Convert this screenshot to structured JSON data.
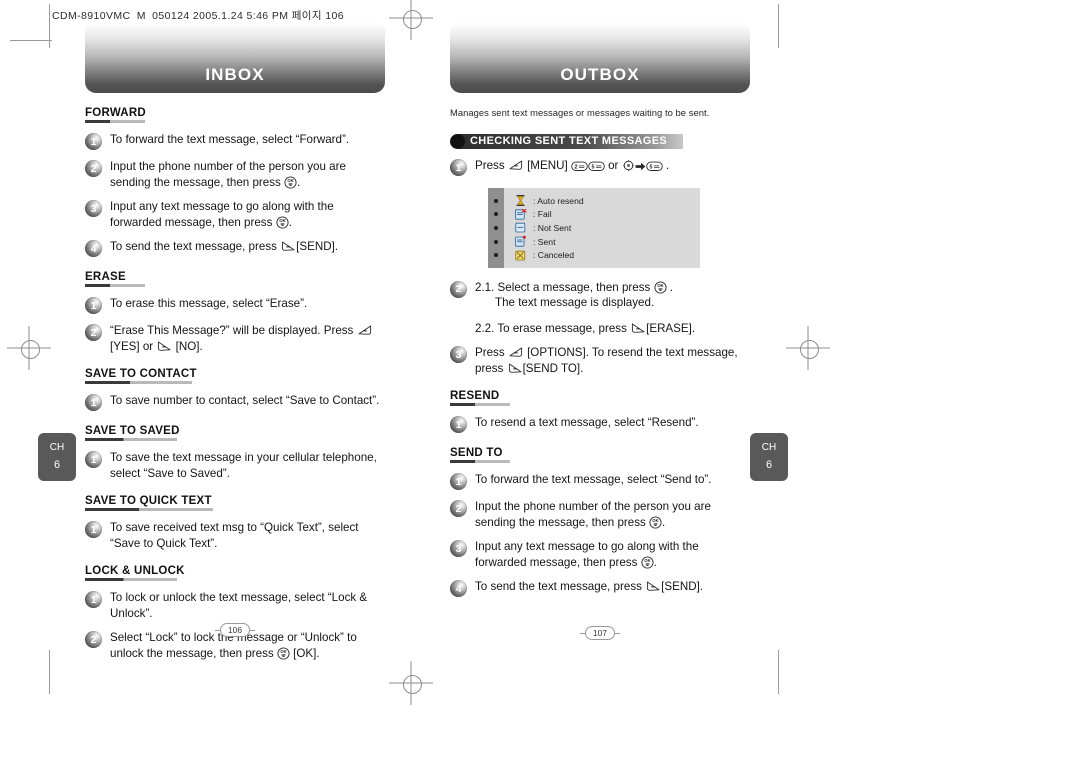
{
  "doc": {
    "header_text": "CDM-8910VMC_M_050124  2005.1.24 5:46 PM 페이지 106"
  },
  "side_tabs": {
    "left": {
      "chapter_label": "CH",
      "chapter_number": "6"
    },
    "right": {
      "chapter_label": "CH",
      "chapter_number": "6"
    }
  },
  "left_page": {
    "banner_title": "INBOX",
    "page_number": "106",
    "sections": [
      {
        "heading": "FORWARD",
        "steps": [
          {
            "num": "1",
            "parts": [
              {
                "t": "text",
                "v": "To forward the text message, select “Forward”."
              }
            ]
          },
          {
            "num": "2",
            "parts": [
              {
                "t": "text",
                "v": "Input the phone number of the person you are sending the message, then press "
              },
              {
                "t": "key",
                "v": "ok-key"
              },
              {
                "t": "text",
                "v": "."
              }
            ]
          },
          {
            "num": "3",
            "parts": [
              {
                "t": "text",
                "v": "Input any text message to go along with the forwarded message, then press "
              },
              {
                "t": "key",
                "v": "ok-key"
              },
              {
                "t": "text",
                "v": "."
              }
            ]
          },
          {
            "num": "4",
            "parts": [
              {
                "t": "text",
                "v": "To send the text message, press "
              },
              {
                "t": "key",
                "v": "right-soft-key"
              },
              {
                "t": "text",
                "v": "[SEND]."
              }
            ]
          }
        ]
      },
      {
        "heading": "ERASE",
        "steps": [
          {
            "num": "1",
            "parts": [
              {
                "t": "text",
                "v": "To erase this message, select “Erase”."
              }
            ]
          },
          {
            "num": "2",
            "parts": [
              {
                "t": "text",
                "v": "“Erase This Message?” will be displayed. Press "
              },
              {
                "t": "key",
                "v": "left-soft-key"
              },
              {
                "t": "text",
                "v": " [YES] or "
              },
              {
                "t": "key",
                "v": "right-soft-key"
              },
              {
                "t": "text",
                "v": " [NO]."
              }
            ]
          }
        ]
      },
      {
        "heading": "SAVE TO CONTACT",
        "steps": [
          {
            "num": "1",
            "parts": [
              {
                "t": "text",
                "v": "To save number to contact, select “Save to Contact”."
              }
            ]
          }
        ]
      },
      {
        "heading": "SAVE TO SAVED",
        "steps": [
          {
            "num": "1",
            "parts": [
              {
                "t": "text",
                "v": "To save the text message in your cellular telephone, select “Save to Saved”."
              }
            ]
          }
        ]
      },
      {
        "heading": "SAVE TO QUICK TEXT",
        "steps": [
          {
            "num": "1",
            "parts": [
              {
                "t": "text",
                "v": "To save received text msg to “Quick Text”, select “Save to Quick Text”."
              }
            ]
          }
        ]
      },
      {
        "heading": "LOCK & UNLOCK",
        "steps": [
          {
            "num": "1",
            "parts": [
              {
                "t": "text",
                "v": "To lock or unlock the text message, select “Lock & Unlock”."
              }
            ]
          },
          {
            "num": "2",
            "parts": [
              {
                "t": "text",
                "v": "Select “Lock” to lock the message or “Unlock” to unlock the message, then press "
              },
              {
                "t": "key",
                "v": "ok-key"
              },
              {
                "t": "text",
                "v": " [OK]."
              }
            ]
          }
        ]
      }
    ]
  },
  "right_page": {
    "banner_title": "OUTBOX",
    "page_number": "107",
    "intro": "Manages sent text messages or messages waiting to be sent.",
    "topic_title": "CHECKING SENT TEXT MESSAGES",
    "topic_steps": [
      {
        "num": "1",
        "parts": [
          {
            "t": "text",
            "v": "Press "
          },
          {
            "t": "key",
            "v": "left-soft-key"
          },
          {
            "t": "text",
            "v": " [MENU] "
          },
          {
            "t": "key",
            "v": "num-2-key"
          },
          {
            "t": "key",
            "v": "num-5-key"
          },
          {
            "t": "text",
            "v": " or "
          },
          {
            "t": "key",
            "v": "navigation-key"
          },
          {
            "t": "key",
            "v": "arrow-right-icon"
          },
          {
            "t": "key",
            "v": "num-5-key"
          },
          {
            "t": "text",
            "v": " ."
          }
        ]
      }
    ],
    "legend": {
      "rows": [
        {
          "icon": "hourglass-icon",
          "label": ": Auto resend"
        },
        {
          "icon": "message-fail-icon",
          "label": ": Fail"
        },
        {
          "icon": "message-not-sent-icon",
          "label": ": Not Sent"
        },
        {
          "icon": "message-sent-icon",
          "label": ": Sent"
        },
        {
          "icon": "message-canceled-icon",
          "label": ": Canceled"
        }
      ]
    },
    "step2": {
      "num": "2",
      "line_a": "2.1. Select a message, then press ",
      "line_a_key": "ok-key",
      "line_a_tail": " .",
      "line_b": "The text message is displayed.",
      "line_c_pre": "2.2. To erase message, press ",
      "line_c_key": "right-soft-key",
      "line_c_tail": "[ERASE]."
    },
    "step3": {
      "num": "3",
      "parts": [
        {
          "t": "text",
          "v": "Press "
        },
        {
          "t": "key",
          "v": "left-soft-key"
        },
        {
          "t": "text",
          "v": " [OPTIONS]. To resend the text message, press "
        },
        {
          "t": "key",
          "v": "right-soft-key"
        },
        {
          "t": "text",
          "v": "[SEND TO]."
        }
      ]
    },
    "sections": [
      {
        "heading": "RESEND",
        "steps": [
          {
            "num": "1",
            "parts": [
              {
                "t": "text",
                "v": "To resend a text message, select “Resend”."
              }
            ]
          }
        ]
      },
      {
        "heading": "SEND TO",
        "steps": [
          {
            "num": "1",
            "parts": [
              {
                "t": "text",
                "v": "To forward the text message, select “Send to”."
              }
            ]
          },
          {
            "num": "2",
            "parts": [
              {
                "t": "text",
                "v": "Input the phone number of the person you are sending the message, then press "
              },
              {
                "t": "key",
                "v": "ok-key"
              },
              {
                "t": "text",
                "v": "."
              }
            ]
          },
          {
            "num": "3",
            "parts": [
              {
                "t": "text",
                "v": "Input any text message to go along with the forwarded message, then press "
              },
              {
                "t": "key",
                "v": "ok-key"
              },
              {
                "t": "text",
                "v": "."
              }
            ]
          },
          {
            "num": "4",
            "parts": [
              {
                "t": "text",
                "v": "To send the text message, press "
              },
              {
                "t": "key",
                "v": "right-soft-key"
              },
              {
                "t": "text",
                "v": "[SEND]."
              }
            ]
          }
        ]
      }
    ]
  },
  "colors": {
    "banner_dark": "#4c4c4c",
    "rule_dark": "#3a3a3a",
    "rule_light": "#b9b9b9",
    "tab_bg": "#595959",
    "legend_bg": "#d9d9d9",
    "legend_rail": "#8f8f8f"
  }
}
